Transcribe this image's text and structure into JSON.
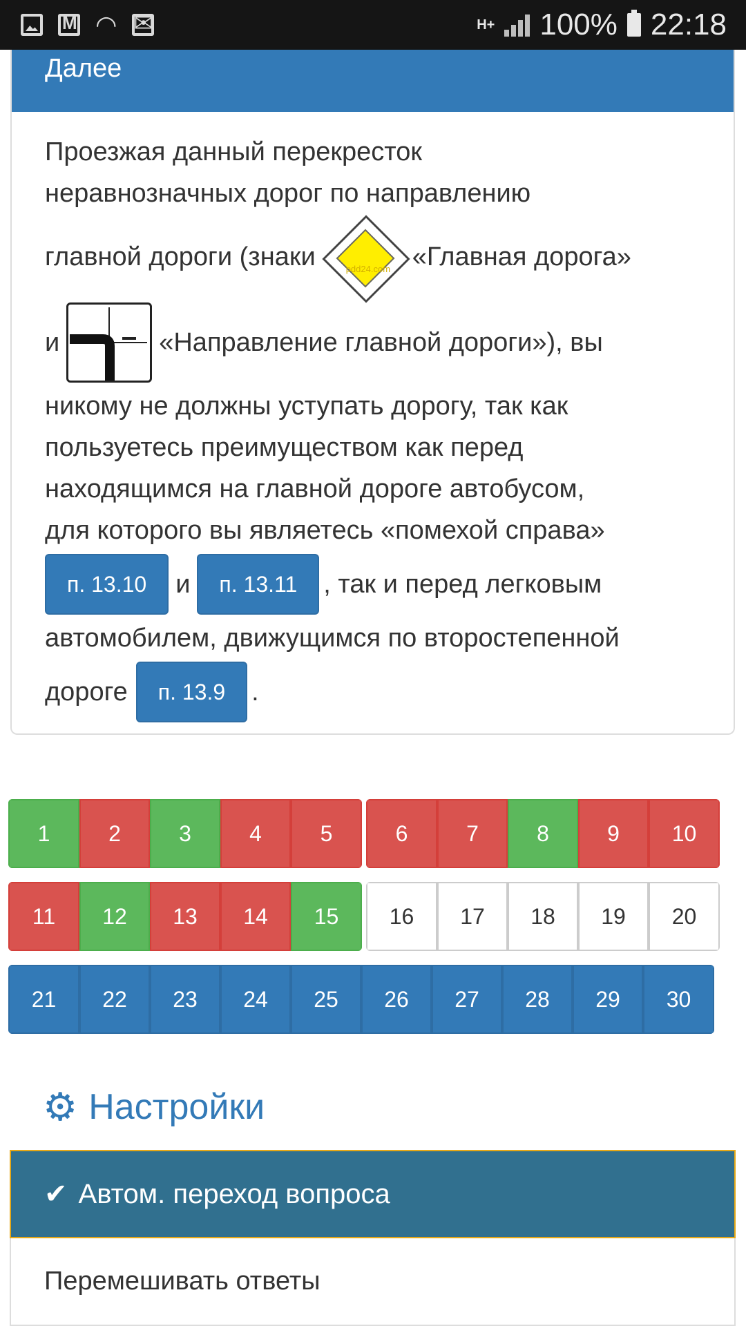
{
  "status_bar": {
    "battery": "100%",
    "time": "22:18",
    "network": "H+"
  },
  "card": {
    "header": "Далее",
    "line1": "Проезжая данный перекресток",
    "line2": "неравнозначных дорог по направлению",
    "line3a": "главной дороги (знаки",
    "line3b": "«Главная дорога»",
    "sign_watermark": "pdd24.com",
    "line4a": "и",
    "line4b": "«Направление главной дороги»), вы",
    "line5": "никому не должны уступать дорогу, так как",
    "line6": "пользуетесь преимуществом как перед",
    "line7": "находящимся на главной дороге автобусом,",
    "line8": "для которого вы являетесь «помехой справа»",
    "ref1": "п. 13.10",
    "and": "и",
    "ref2": "п. 13.11",
    "line9b": ", так и перед легковым",
    "line10": "автомобилем, движущимся по второстепенной",
    "line11a": "дороге",
    "ref3": "п. 13.9",
    "dot": "."
  },
  "questions": [
    {
      "n": "1",
      "s": "correct"
    },
    {
      "n": "2",
      "s": "wrong"
    },
    {
      "n": "3",
      "s": "correct"
    },
    {
      "n": "4",
      "s": "wrong"
    },
    {
      "n": "5",
      "s": "wrong"
    },
    {
      "n": "6",
      "s": "wrong"
    },
    {
      "n": "7",
      "s": "wrong"
    },
    {
      "n": "8",
      "s": "correct"
    },
    {
      "n": "9",
      "s": "wrong"
    },
    {
      "n": "10",
      "s": "wrong"
    },
    {
      "n": "11",
      "s": "wrong"
    },
    {
      "n": "12",
      "s": "correct"
    },
    {
      "n": "13",
      "s": "wrong"
    },
    {
      "n": "14",
      "s": "wrong"
    },
    {
      "n": "15",
      "s": "correct"
    },
    {
      "n": "16",
      "s": "unanswered"
    },
    {
      "n": "17",
      "s": "unanswered"
    },
    {
      "n": "18",
      "s": "unanswered"
    },
    {
      "n": "19",
      "s": "unanswered"
    },
    {
      "n": "20",
      "s": "unanswered"
    },
    {
      "n": "21",
      "s": "extra"
    },
    {
      "n": "22",
      "s": "extra"
    },
    {
      "n": "23",
      "s": "extra"
    },
    {
      "n": "24",
      "s": "extra"
    },
    {
      "n": "25",
      "s": "extra"
    },
    {
      "n": "26",
      "s": "extra"
    },
    {
      "n": "27",
      "s": "extra"
    },
    {
      "n": "28",
      "s": "extra"
    },
    {
      "n": "29",
      "s": "extra"
    },
    {
      "n": "30",
      "s": "extra"
    }
  ],
  "colors": {
    "correct": "#5cb85c",
    "wrong": "#d9534f",
    "extra": "#337ab7",
    "accent": "#337ab7",
    "active_option": "#31708f"
  },
  "settings": {
    "title": "Настройки",
    "options": [
      {
        "label": "Автом. переход вопроса",
        "active": true
      },
      {
        "label": "Перемешивать ответы",
        "active": false
      }
    ]
  }
}
